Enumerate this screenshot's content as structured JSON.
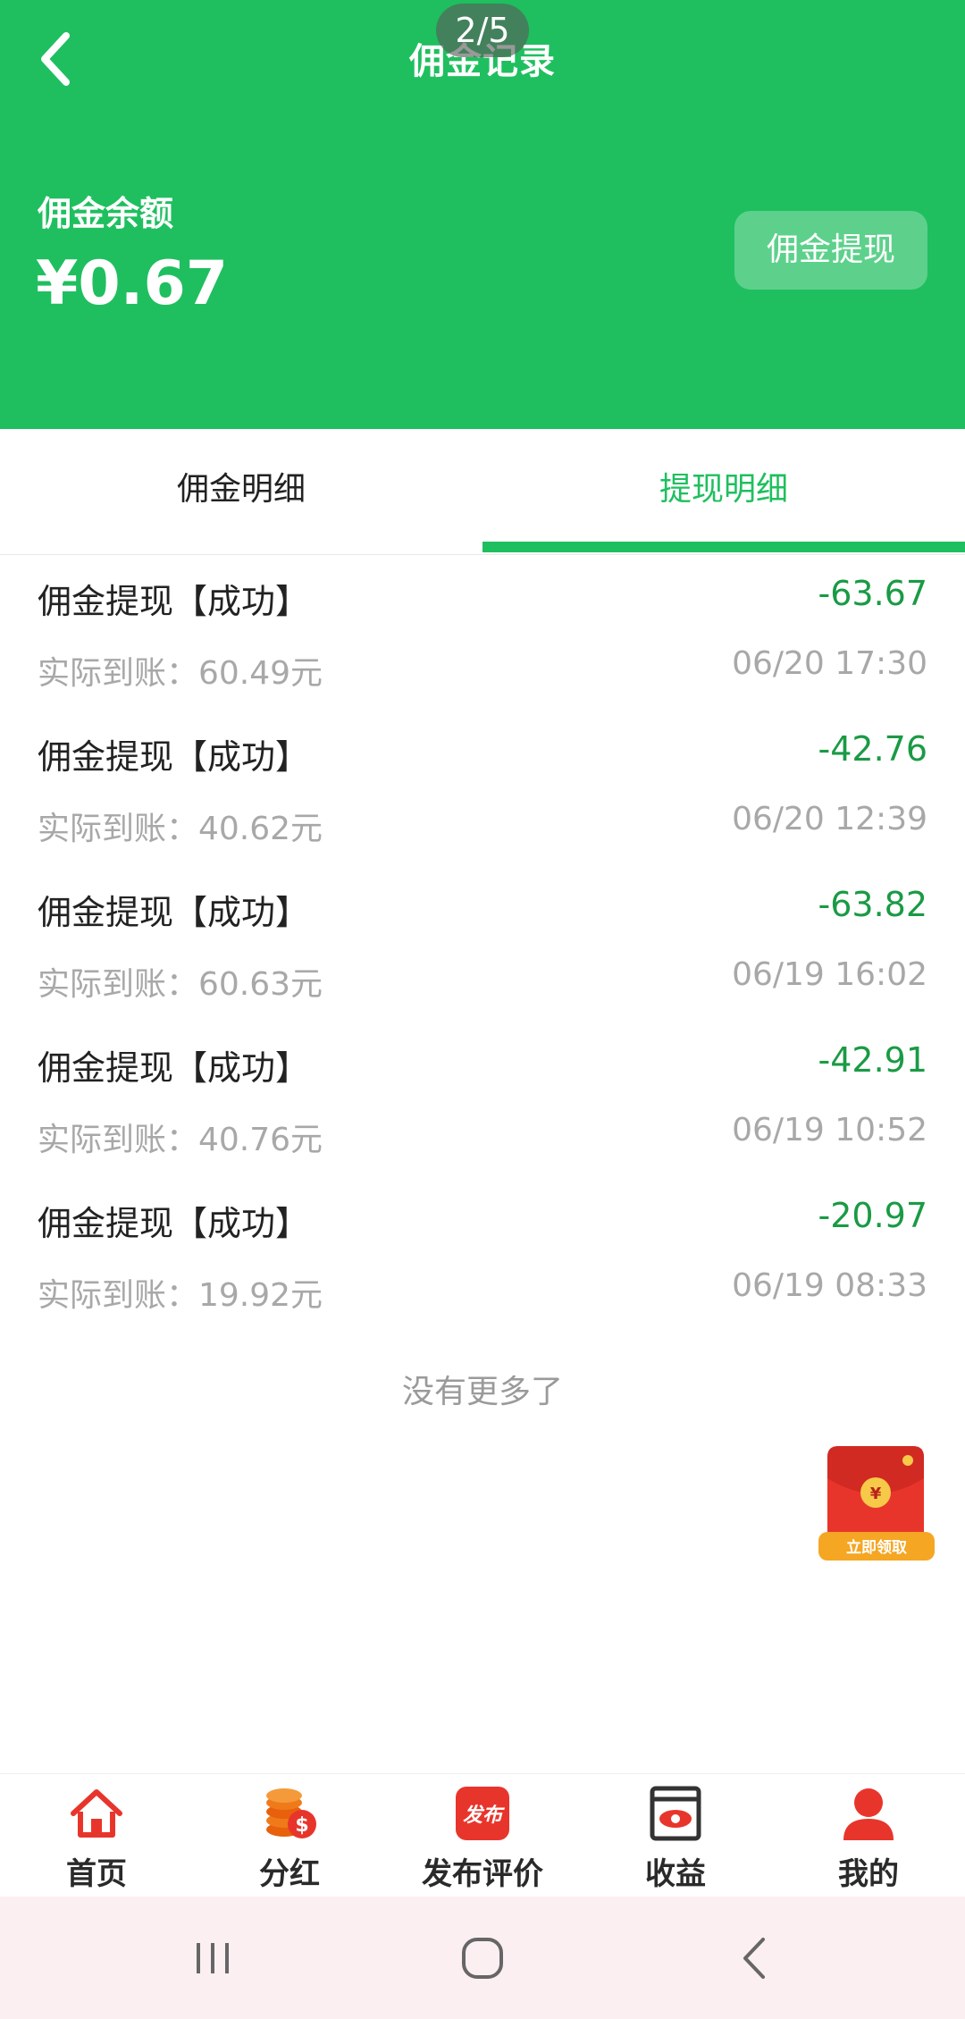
{
  "header": {
    "title": "佣金记录",
    "page_indicator": "2/5",
    "balance_label": "佣金余额",
    "balance_amount": "¥0.67",
    "withdraw_button": "佣金提现"
  },
  "tabs": [
    {
      "label": "佣金明细",
      "active": false
    },
    {
      "label": "提现明细",
      "active": true
    }
  ],
  "records": [
    {
      "title": "佣金提现【成功】",
      "amount": "-63.67",
      "actual": "实际到账：60.49元",
      "time": "06/20 17:30"
    },
    {
      "title": "佣金提现【成功】",
      "amount": "-42.76",
      "actual": "实际到账：40.62元",
      "time": "06/20 12:39"
    },
    {
      "title": "佣金提现【成功】",
      "amount": "-63.82",
      "actual": "实际到账：60.63元",
      "time": "06/19 16:02"
    },
    {
      "title": "佣金提现【成功】",
      "amount": "-42.91",
      "actual": "实际到账：40.76元",
      "time": "06/19 10:52"
    },
    {
      "title": "佣金提现【成功】",
      "amount": "-20.97",
      "actual": "实际到账：19.92元",
      "time": "06/19 08:33"
    }
  ],
  "no_more": "没有更多了",
  "red_packet": {
    "symbol": "¥",
    "label": "立即领取"
  },
  "bottom_nav": [
    {
      "label": "首页",
      "icon": "home-icon"
    },
    {
      "label": "分红",
      "icon": "coins-icon"
    },
    {
      "label": "发布评价",
      "icon": "publish-icon",
      "icon_text": "发布"
    },
    {
      "label": "收益",
      "icon": "earnings-icon"
    },
    {
      "label": "我的",
      "icon": "profile-icon"
    }
  ],
  "colors": {
    "brand_green": "#1fbf5f",
    "amount_green": "#1a9a45",
    "icon_red": "#e8352c"
  }
}
